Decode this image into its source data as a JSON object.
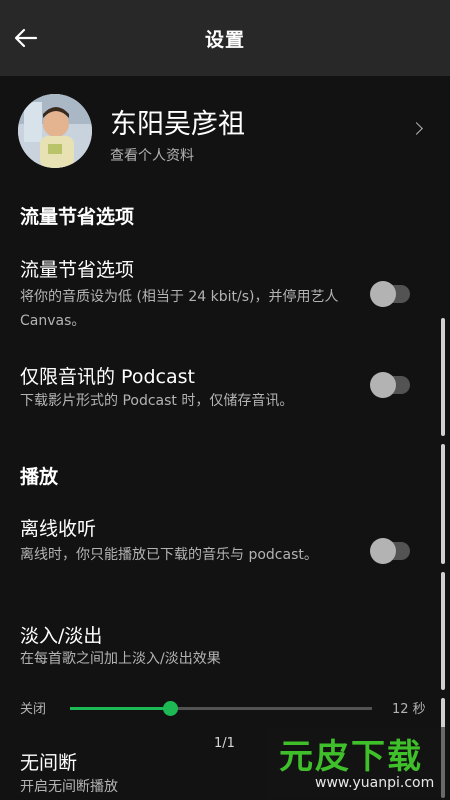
{
  "header": {
    "title": "设置"
  },
  "profile": {
    "name": "东阳吴彦祖",
    "subtitle": "查看个人资料"
  },
  "sections": {
    "data_saver": {
      "heading": "流量节省选项",
      "items": [
        {
          "title": "流量节省选项",
          "desc": "将你的音质设为低 (相当于 24 kbit/s)，并停用艺人 Canvas。",
          "enabled": false
        },
        {
          "title": "仅限音讯的 Podcast",
          "desc": "下载影片形式的 Podcast 时，仅储存音讯。",
          "enabled": false
        }
      ]
    },
    "playback": {
      "heading": "播放",
      "items": [
        {
          "title": "离线收听",
          "desc": "离线时，你只能播放已下载的音乐与 podcast。",
          "enabled": false
        },
        {
          "title": "淡入/淡出",
          "desc": "在每首歌之间加上淡入/淡出效果"
        }
      ]
    }
  },
  "crossfade": {
    "min_label": "关闭",
    "max_label": "12 秒",
    "fraction": 0.33
  },
  "gapless": {
    "title": "无间断",
    "desc": "开启无间断播放"
  },
  "page_indicator": "1/1",
  "watermark": {
    "logo": "元皮下载",
    "url": "www.yuanpi.com"
  },
  "colors": {
    "accent": "#1db954",
    "background": "#121212",
    "header": "#282828"
  }
}
